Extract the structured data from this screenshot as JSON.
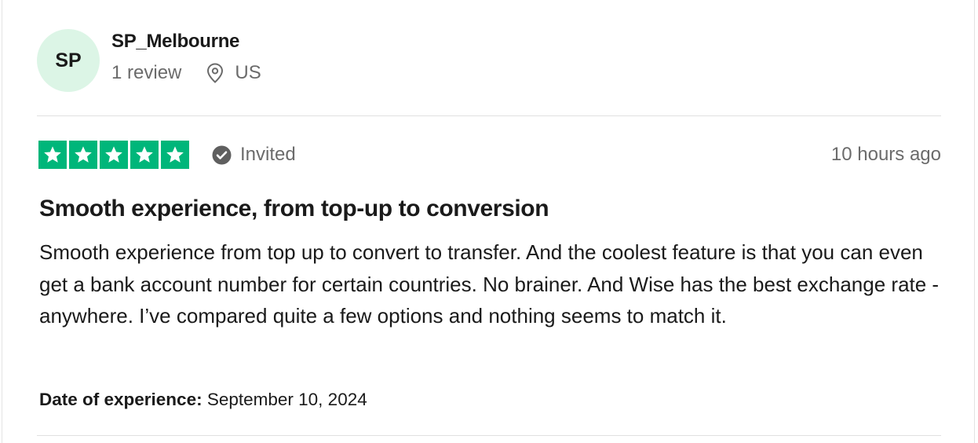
{
  "consumer": {
    "initials": "SP",
    "name": "SP_Melbourne",
    "review_count": "1 review",
    "location": "US",
    "avatar_color": "#dcf5e6"
  },
  "rating": {
    "stars": 5,
    "max_stars": 5,
    "star_color": "#00b67a",
    "verification_label": "Invited",
    "verification_icon": "check-circle-icon",
    "date_posted": "10 hours ago"
  },
  "review": {
    "title": "Smooth experience, from top-up to conversion",
    "body": "Smooth experience from top up to convert to transfer. And the coolest feature is that you can even get a bank account number for certain countries. No brainer. And Wise has the best exchange rate - anywhere. I’ve compared quite a few options and nothing seems to match it.",
    "experience_label": "Date of experience:",
    "experience_date": "September 10, 2024"
  }
}
